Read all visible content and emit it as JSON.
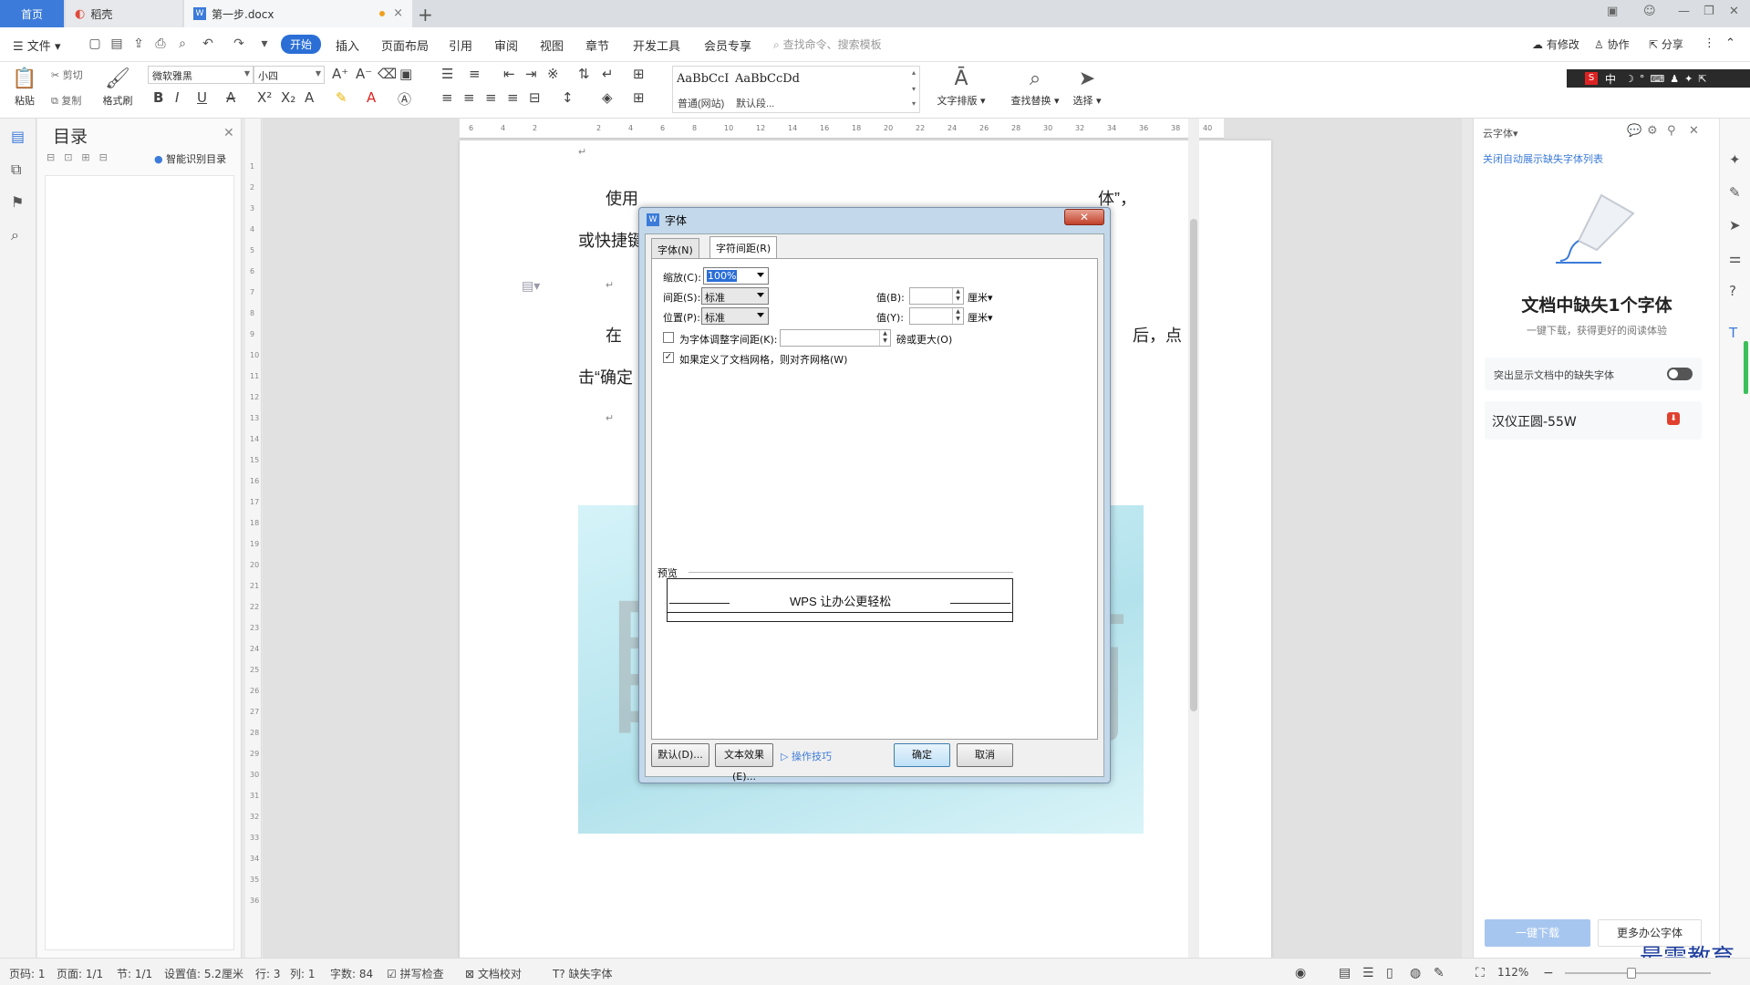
{
  "titlebar": {
    "tab_home": "首页",
    "tab_shell": "稻壳",
    "tab_doc": "第一步.docx",
    "tab_add": "+",
    "tab_close": "×"
  },
  "menubar": {
    "file": "文件",
    "start": "开始",
    "insert": "插入",
    "layout": "页面布局",
    "reference": "引用",
    "review": "审阅",
    "view": "视图",
    "chapter": "章节",
    "dev": "开发工具",
    "member": "会员专享",
    "search": "查找命令、搜索模板",
    "modified": "有修改",
    "collab": "协作",
    "share": "分享"
  },
  "ribbon": {
    "paste": "粘贴",
    "cut": "剪切",
    "copy": "复制",
    "format_painter": "格式刷",
    "font_name": "微软雅黑",
    "font_size": "小四",
    "style1_preview": "AaBbCcI",
    "style1_name": "普通(网站)",
    "style2_preview": "AaBbCcDd",
    "style2_name": "默认段...",
    "text_layout": "文字排版",
    "find_replace": "查找替换",
    "select": "选择",
    "ime_label": "中"
  },
  "toc": {
    "title": "目录",
    "smart": "智能识别目录"
  },
  "ruler": {
    "h_ticks": [
      "6",
      "4",
      "2",
      "",
      "2",
      "4",
      "6",
      "8",
      "10",
      "12",
      "14",
      "16",
      "18",
      "20",
      "22",
      "24",
      "26",
      "28",
      "30",
      "32",
      "34",
      "36",
      "38",
      "40"
    ],
    "v_ticks": [
      "1",
      "2",
      "3",
      "4",
      "5",
      "6",
      "7",
      "8",
      "9",
      "10",
      "11",
      "12",
      "13",
      "14",
      "15",
      "16",
      "17",
      "18",
      "19",
      "20",
      "21",
      "22",
      "23",
      "24",
      "25",
      "26",
      "27",
      "28",
      "29",
      "30",
      "31",
      "32",
      "33",
      "34",
      "35",
      "36"
    ]
  },
  "document": {
    "line1_start": "使用",
    "line1_end": "体”，",
    "line2": "或快捷键",
    "line3_start": "在",
    "line3_end": "后，点",
    "line4": "击“确定",
    "ghost_left": "目",
    "ghost_right": "简",
    "para_mark": "↵"
  },
  "dialog": {
    "title": "字体",
    "tab_font": "字体(N)",
    "tab_spacing": "字符间距(R)",
    "scale_label": "缩放(C):",
    "scale_value": "100%",
    "spacing_label": "间距(S):",
    "spacing_value": "标准",
    "position_label": "位置(P):",
    "position_value": "标准",
    "value_b_label": "值(B):",
    "value_y_label": "值(Y):",
    "unit_cm": "厘米▾",
    "kerning_label": "为字体调整字间距(K):",
    "kerning_suffix": "磅或更大(O)",
    "kerning_checked": false,
    "grid_label": "如果定义了文档网格，则对齐网格(W)",
    "grid_checked": true,
    "preview_label": "预览",
    "preview_text": "WPS 让办公更轻松",
    "btn_default": "默认(D)...",
    "btn_effects": "文本效果(E)...",
    "tips": "操作技巧",
    "btn_ok": "确定",
    "btn_cancel": "取消",
    "close": "✕"
  },
  "cloudfont": {
    "header": "云字体",
    "header_arrow": "▾",
    "close_auto": "关闭自动展示缺失字体列表",
    "title": "文档中缺失1个字体",
    "subtitle": "一键下载，获得更好的阅读体验",
    "highlight_toggle": "突出显示文档中的缺失字体",
    "missing_font": "汉仪正圆-55W",
    "download_btn": "一键下载",
    "more_btn": "更多办公字体",
    "watermark": "最需教育"
  },
  "status": {
    "page": "页码: 1",
    "pages": "页面: 1/1",
    "section": "节: 1/1",
    "setting": "设置值: 5.2厘米",
    "row": "行: 3",
    "col": "列: 1",
    "words": "字数: 84",
    "spell": "拼写检查",
    "proof": "文档校对",
    "missing_font": "缺失字体",
    "zoom": "112%"
  },
  "colors": {
    "accent": "#2b6fd6",
    "tab_home": "#3c7bd9",
    "toolbar_bg": "#ffffff",
    "status_bg": "#f3f3f3"
  }
}
